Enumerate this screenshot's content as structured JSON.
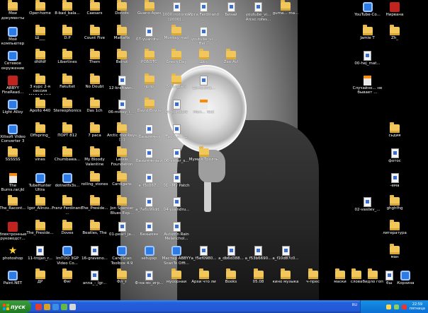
{
  "desktop": {
    "icons": [
      {
        "label": "Мои документы",
        "type": "folder",
        "col": 0,
        "row": 0
      },
      {
        "label": "Oper-home",
        "type": "folder",
        "col": 1,
        "row": 0
      },
      {
        "label": "8-bad_bala...",
        "type": "folder",
        "col": 2,
        "row": 0
      },
      {
        "label": "Caesars",
        "type": "folder",
        "col": 3,
        "row": 0
      },
      {
        "label": "Donots",
        "type": "folder",
        "col": 4,
        "row": 0
      },
      {
        "label": "Guano Apes",
        "type": "folder",
        "col": 5,
        "row": 0
      },
      {
        "label": "1000 потолок [2000]...",
        "type": "file",
        "col": 6,
        "row": 0
      },
      {
        "label": "Ирга Ferdinand ...",
        "type": "file",
        "col": 7,
        "row": 0
      },
      {
        "label": "Бизай",
        "type": "file",
        "col": 8,
        "row": 0
      },
      {
        "label": "youtube_vi... Arcsc rofes...",
        "type": "file",
        "col": 9,
        "row": 0
      },
      {
        "label": "gumа... ma...",
        "type": "folder",
        "col": 10,
        "row": 0
      },
      {
        "label": "YouTube-Co...",
        "type": "app",
        "col": 13,
        "row": 0
      },
      {
        "label": "Нирвана",
        "type": "red",
        "col": 14,
        "row": 0
      },
      {
        "label": "Мой компьютер",
        "type": "app",
        "col": 0,
        "row": 1
      },
      {
        "label": "Ш___",
        "type": "folder",
        "col": 1,
        "row": 1
      },
      {
        "label": "D.P",
        "type": "folder",
        "col": 2,
        "row": 1
      },
      {
        "label": "Count Five",
        "type": "folder",
        "col": 3,
        "row": 1
      },
      {
        "label": "Mattafix",
        "type": "folder",
        "col": 4,
        "row": 1
      },
      {
        "label": "07-yuandru...",
        "type": "file",
        "col": 5,
        "row": 1
      },
      {
        "label": "Monkey mail",
        "type": "folder",
        "col": 6,
        "row": 1
      },
      {
        "label": "youtube_vi... Hei...",
        "type": "file",
        "col": 7,
        "row": 1
      },
      {
        "label": "Jamie T",
        "type": "folder",
        "col": 13,
        "row": 1
      },
      {
        "label": "Zh_",
        "type": "folder",
        "col": 14,
        "row": 1
      },
      {
        "label": "Сетевое окружение",
        "type": "app",
        "col": 0,
        "row": 2
      },
      {
        "label": "dfdfdf",
        "type": "folder",
        "col": 1,
        "row": 2
      },
      {
        "label": "Libertines",
        "type": "folder",
        "col": 2,
        "row": 2
      },
      {
        "label": "Them",
        "type": "folder",
        "col": 3,
        "row": 2
      },
      {
        "label": "Beirut",
        "type": "folder",
        "col": 4,
        "row": 2
      },
      {
        "label": "РОБОТС",
        "type": "folder",
        "col": 5,
        "row": 2
      },
      {
        "label": "Green Day",
        "type": "folder",
        "col": 6,
        "row": 2
      },
      {
        "label": "Шоу",
        "type": "folder",
        "col": 7,
        "row": 2
      },
      {
        "label": "Zee Avi",
        "type": "folder",
        "col": 8,
        "row": 2
      },
      {
        "label": "00-hej_mat...",
        "type": "file",
        "col": 13,
        "row": 2
      },
      {
        "label": "ABBYY FineRead...",
        "type": "red",
        "col": 0,
        "row": 3
      },
      {
        "label": "3 курс 2-я сессия МАЗАФАКА",
        "type": "folder",
        "col": 1,
        "row": 3
      },
      {
        "label": "Fakultet",
        "type": "folder",
        "col": 2,
        "row": 3
      },
      {
        "label": "No Doubt",
        "type": "folder",
        "col": 3,
        "row": 3
      },
      {
        "label": "12-kraftwer...",
        "type": "file",
        "col": 4,
        "row": 3
      },
      {
        "label": "прпр",
        "type": "folder",
        "col": 5,
        "row": 3
      },
      {
        "label": "Stranglers",
        "type": "folder",
        "col": 6,
        "row": 3
      },
      {
        "label": "10-nadwa...",
        "type": "file",
        "col": 7,
        "row": 3
      },
      {
        "label": "Случайно... не бывает ...",
        "type": "doc",
        "col": 13,
        "row": 3
      },
      {
        "label": "Light Alloy",
        "type": "app",
        "col": 0,
        "row": 4
      },
      {
        "label": "Apollo 440",
        "type": "folder",
        "col": 1,
        "row": 4
      },
      {
        "label": "Stereophonics",
        "type": "folder",
        "col": 2,
        "row": 4
      },
      {
        "label": "Das 1ch",
        "type": "folder",
        "col": 3,
        "row": 4
      },
      {
        "label": "06-mihey_i_...",
        "type": "file",
        "col": 4,
        "row": 4
      },
      {
        "label": "David Bowie",
        "type": "folder",
        "col": 5,
        "row": 4
      },
      {
        "label": "06-portable",
        "type": "file",
        "col": 6,
        "row": 4
      },
      {
        "label": "Мол... Test",
        "type": "doc",
        "col": 7,
        "row": 4
      },
      {
        "label": "Xilisoft Video Converter 3",
        "type": "app",
        "col": 0,
        "row": 5
      },
      {
        "label": "Offspring_",
        "type": "folder",
        "col": 1,
        "row": 5
      },
      {
        "label": "ПОРТ 812",
        "type": "folder",
        "col": 2,
        "row": 5
      },
      {
        "label": "7 раса",
        "type": "folder",
        "col": 3,
        "row": 5
      },
      {
        "label": "Arctic monkeys [..]",
        "type": "folder",
        "col": 4,
        "row": 5
      },
      {
        "label": "Безымянн",
        "type": "file",
        "col": 5,
        "row": 5
      },
      {
        "label": "Тролли... 1",
        "type": "file",
        "col": 6,
        "row": 5
      },
      {
        "label": "сьдия",
        "type": "folder",
        "col": 14,
        "row": 5
      },
      {
        "label": "SSSSSS",
        "type": "folder",
        "col": 0,
        "row": 6
      },
      {
        "label": "vines",
        "type": "folder",
        "col": 1,
        "row": 6
      },
      {
        "label": "Chumbawa...",
        "type": "folder",
        "col": 2,
        "row": 6
      },
      {
        "label": "My Bloody Valentine",
        "type": "folder",
        "col": 3,
        "row": 6
      },
      {
        "label": "Lassie Foundation",
        "type": "folder",
        "col": 4,
        "row": 6
      },
      {
        "label": "Безымянный",
        "type": "file",
        "col": 5,
        "row": 6
      },
      {
        "label": "06-sister_s...",
        "type": "file",
        "col": 6,
        "row": 6
      },
      {
        "label": "Мумий Тролль",
        "type": "folder",
        "col": 7,
        "row": 6
      },
      {
        "label": "фотос",
        "type": "file",
        "col": 14,
        "row": 6
      },
      {
        "label": "The Burns.rar.jkl",
        "type": "doc",
        "col": 0,
        "row": 7
      },
      {
        "label": "TubeHunter Ultra",
        "type": "app",
        "col": 1,
        "row": 7
      },
      {
        "label": "dotnetfx3s...",
        "type": "app",
        "col": 2,
        "row": 7
      },
      {
        "label": "rolling_stones",
        "type": "folder",
        "col": 3,
        "row": 7
      },
      {
        "label": "Cardigans",
        "type": "folder",
        "col": 4,
        "row": 7
      },
      {
        "label": "a_f3c067...",
        "type": "file",
        "col": 5,
        "row": 7
      },
      {
        "label": "01 - My Patch",
        "type": "file",
        "col": 6,
        "row": 7
      },
      {
        "label": "-ема",
        "type": "file",
        "col": 14,
        "row": 7
      },
      {
        "label": "The_Racont...",
        "type": "folder",
        "col": 0,
        "row": 8
      },
      {
        "label": "Igor_Alinov...",
        "type": "folder",
        "col": 1,
        "row": 8
      },
      {
        "label": "Franz Ferdinand ...",
        "type": "folder",
        "col": 2,
        "row": 8
      },
      {
        "label": "The_Preside...",
        "type": "folder",
        "col": 3,
        "row": 8
      },
      {
        "label": "Jon Spencer Blues Exp...",
        "type": "folder",
        "col": 4,
        "row": 8
      },
      {
        "label": "a_7e6c99dd...",
        "type": "file",
        "col": 5,
        "row": 8
      },
      {
        "label": "04-yuandru...",
        "type": "file",
        "col": 6,
        "row": 8
      },
      {
        "label": "02-vasilev_...",
        "type": "file",
        "col": 13,
        "row": 8
      },
      {
        "label": "ghghfhg",
        "type": "folder",
        "col": 14,
        "row": 8
      },
      {
        "label": "Электронные руководст...",
        "type": "red",
        "col": 0,
        "row": 9
      },
      {
        "label": "The_Preside...",
        "type": "folder",
        "col": 1,
        "row": 9
      },
      {
        "label": "Doves",
        "type": "folder",
        "col": 2,
        "row": 9
      },
      {
        "label": "Beatles, The",
        "type": "folder",
        "col": 3,
        "row": 9
      },
      {
        "label": "01-pearl_ja...",
        "type": "file",
        "col": 4,
        "row": 9
      },
      {
        "label": "Безымян",
        "type": "file",
        "col": 5,
        "row": 9
      },
      {
        "label": "Autumn Rain Melanchol...",
        "type": "file",
        "col": 6,
        "row": 9
      },
      {
        "label": "литература",
        "type": "folder",
        "col": 14,
        "row": 9
      },
      {
        "label": "photoshop",
        "type": "star",
        "col": 0,
        "row": 10
      },
      {
        "label": "11-trojan_r...",
        "type": "file",
        "col": 1,
        "row": 10
      },
      {
        "label": "ImTOO 3GP Video Co...",
        "type": "app",
        "col": 2,
        "row": 10
      },
      {
        "label": "16-graveno...",
        "type": "file",
        "col": 3,
        "row": 10
      },
      {
        "label": "CanoScan Toolbox 4.9",
        "type": "app",
        "col": 4,
        "row": 10
      },
      {
        "label": "setupxp",
        "type": "app",
        "col": 5,
        "row": 10
      },
      {
        "label": "Мастер ABBYY ScanTo Offi...",
        "type": "app",
        "col": 6,
        "row": 10
      },
      {
        "label": "a_f5ef0980...",
        "type": "file",
        "col": 7,
        "row": 10
      },
      {
        "label": "a_db6d388...",
        "type": "file",
        "col": 8,
        "row": 10
      },
      {
        "label": "a_f53b6690...",
        "type": "file",
        "col": 9,
        "row": 10
      },
      {
        "label": "a_f10d87c0...",
        "type": "file",
        "col": 10,
        "row": 10
      },
      {
        "label": "ман",
        "type": "folder",
        "col": 14,
        "row": 10
      },
      {
        "label": "Paint.NET",
        "type": "app",
        "col": 0,
        "row": 11
      },
      {
        "label": "ДР",
        "type": "folder",
        "col": 1,
        "row": 11
      },
      {
        "label": "Фяг",
        "type": "folder",
        "col": 2,
        "row": 11
      },
      {
        "label": "anna_-_Igr...",
        "type": "file",
        "col": 3,
        "row": 11
      },
      {
        "label": "Фл_т",
        "type": "folder",
        "col": 4,
        "row": 11
      },
      {
        "label": "Ф-ка-ян_игр...",
        "type": "file",
        "col": 5,
        "row": 11
      },
      {
        "label": "муоорнаи",
        "type": "folder",
        "col": 6,
        "row": 11
      },
      {
        "label": "Архи что ли",
        "type": "folder",
        "col": 7,
        "row": 11
      },
      {
        "label": "Books",
        "type": "folder",
        "col": 8,
        "row": 11
      },
      {
        "label": "05.08",
        "type": "folder",
        "col": 9,
        "row": 11
      },
      {
        "label": "кино музыка",
        "type": "folder",
        "col": 10,
        "row": 11
      },
      {
        "label": "ч-прес",
        "type": "folder",
        "col": 11,
        "row": 11
      },
      {
        "label": "маски",
        "type": "folder",
        "col": 12,
        "row": 11
      },
      {
        "label": "слова",
        "type": "folder",
        "col": 12.6,
        "row": 11
      },
      {
        "label": "бидло гоп",
        "type": "folder",
        "col": 13.2,
        "row": 11
      },
      {
        "label": "бш",
        "type": "file",
        "col": 13.8,
        "row": 11
      },
      {
        "label": "Корзина",
        "type": "app",
        "col": 14.4,
        "row": 11
      }
    ]
  },
  "taskbar": {
    "start_label": "пуск",
    "lang": "RU",
    "clock_time": "22:59",
    "clock_day": "пятница"
  },
  "colors": {
    "taskbar": "#245edb",
    "start": "#2d8c30",
    "tray": "#0c6fd4"
  }
}
